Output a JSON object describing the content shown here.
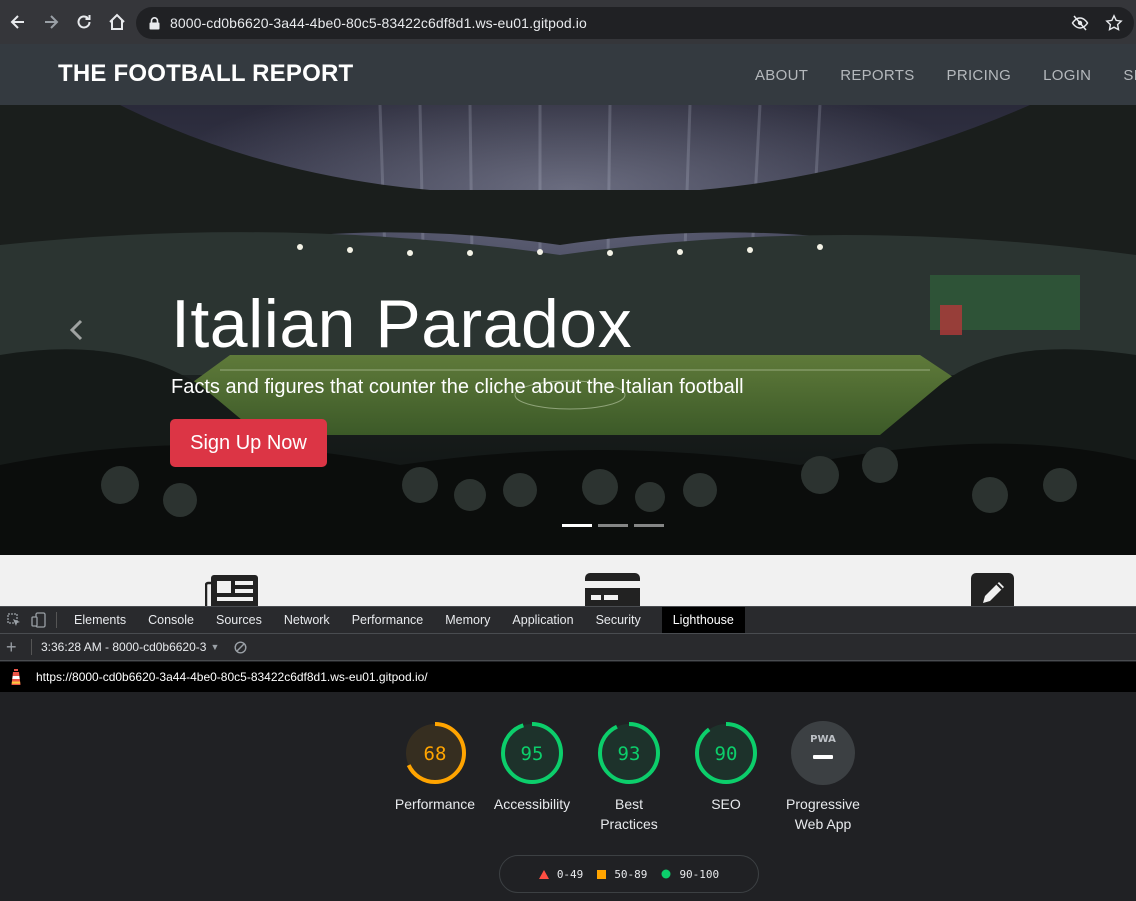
{
  "browser": {
    "url": "8000-cd0b6620-3a44-4be0-80c5-83422c6df8d1.ws-eu01.gitpod.io"
  },
  "site": {
    "brand": "THE FOOTBALL REPORT",
    "nav": [
      "ABOUT",
      "REPORTS",
      "PRICING",
      "LOGIN",
      "SIGN U"
    ],
    "hero": {
      "title": "Italian Paradox",
      "subtitle": "Facts and figures that counter the cliche about the Italian football",
      "cta": "Sign Up Now",
      "active_slide": 1,
      "slide_count": 3
    },
    "features": [
      "newspaper-icon",
      "credit-card-icon",
      "pencil-square-icon"
    ]
  },
  "devtools": {
    "tabs": [
      "Elements",
      "Console",
      "Sources",
      "Network",
      "Performance",
      "Memory",
      "Application",
      "Security",
      "Lighthouse"
    ],
    "active_tab": "Lighthouse",
    "report_select": "3:36:28 AM - 8000-cd0b6620-3",
    "report_url": "https://8000-cd0b6620-3a44-4be0-80c5-83422c6df8d1.ws-eu01.gitpod.io/"
  },
  "lighthouse": {
    "scores": [
      {
        "label": "Performance",
        "score": 68,
        "color": "#ffa400"
      },
      {
        "label": "Accessibility",
        "score": 95,
        "color": "#0cce6b"
      },
      {
        "label": "Best Practices",
        "score": 93,
        "color": "#0cce6b"
      },
      {
        "label": "SEO",
        "score": 90,
        "color": "#0cce6b"
      }
    ],
    "pwa": {
      "label": "Progressive Web App",
      "badge": "PWA"
    },
    "legend": [
      {
        "range": "0-49",
        "color": "#ff4e42",
        "shape": "triangle"
      },
      {
        "range": "50-89",
        "color": "#ffa400",
        "shape": "square"
      },
      {
        "range": "90-100",
        "color": "#0cce6b",
        "shape": "circle"
      }
    ]
  }
}
